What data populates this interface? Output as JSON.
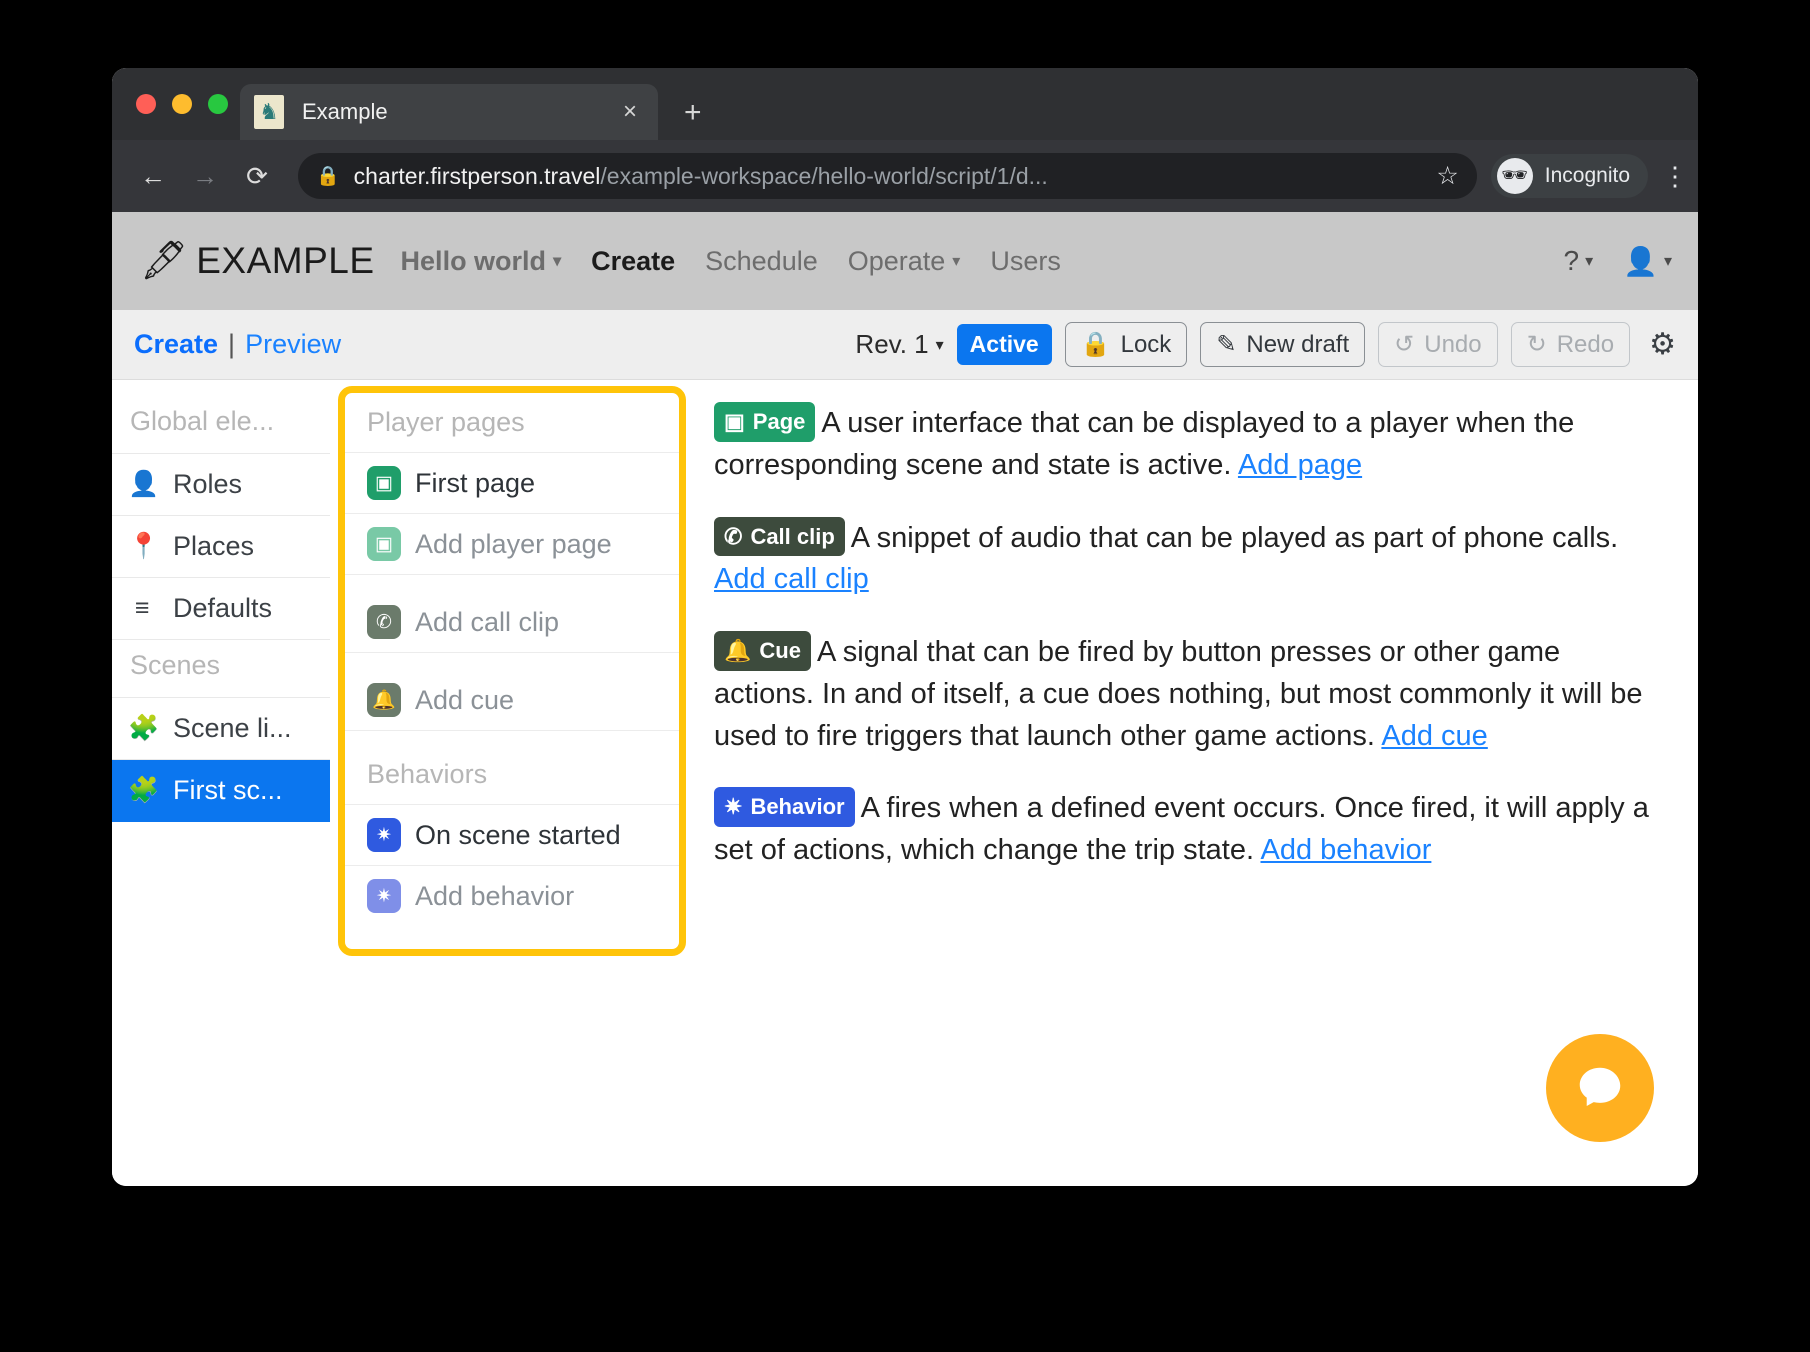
{
  "browser": {
    "tab": {
      "title": "Example",
      "favicon_icon": "chess-knight-icon",
      "close_icon": "×"
    },
    "new_tab_icon": "+",
    "nav": {
      "back_icon": "←",
      "forward_icon": "→",
      "reload_icon": "⟳"
    },
    "url": {
      "lock_icon": "lock-icon",
      "host": "charter.firstperson.travel",
      "path": "/example-workspace/hello-world/script/1/d...",
      "star_icon": "☆"
    },
    "profile": {
      "label": "Incognito",
      "icon": "incognito-hat-icon"
    },
    "menu_icon": "⋮"
  },
  "appnav": {
    "brand": "EXAMPLE",
    "brand_icon": "quill-ink-icon",
    "items": [
      {
        "label": "Hello world",
        "caret": "▾",
        "style": "bold"
      },
      {
        "label": "Create",
        "caret": "",
        "style": "active"
      },
      {
        "label": "Schedule",
        "caret": "",
        "style": "normal"
      },
      {
        "label": "Operate",
        "caret": "▾",
        "style": "normal"
      },
      {
        "label": "Users",
        "caret": "",
        "style": "normal"
      }
    ],
    "help_icon": "?",
    "help_caret": "▾",
    "user_icon": "person-icon",
    "user_caret": "▾"
  },
  "toolbar": {
    "create": "Create",
    "separator": "|",
    "preview": "Preview",
    "revision": "Rev. 1",
    "revision_caret": "▾",
    "status_badge": "Active",
    "lock": "Lock",
    "lock_icon": "padlock-icon",
    "new_draft": "New draft",
    "new_draft_icon": "pencil-icon",
    "undo": "Undo",
    "undo_icon": "undo-arrow-icon",
    "redo": "Redo",
    "redo_icon": "redo-arrow-icon",
    "settings_icon": "gear-icon"
  },
  "sidebar": {
    "group_global": "Global ele...",
    "group_scenes": "Scenes",
    "items": [
      {
        "label": "Roles",
        "icon": "person-icon",
        "selected": false
      },
      {
        "label": "Places",
        "icon": "map-pin-icon",
        "selected": false
      },
      {
        "label": "Defaults",
        "icon": "list-icon",
        "selected": false
      }
    ],
    "scenes": [
      {
        "label": "Scene li...",
        "icon": "puzzle-piece-icon",
        "selected": false
      },
      {
        "label": "First sc...",
        "icon": "puzzle-piece-icon",
        "selected": true
      }
    ]
  },
  "panel": {
    "group_player_pages": "Player pages",
    "group_behaviors": "Behaviors",
    "items": [
      {
        "label": "First page",
        "icon": "page-icon",
        "tone": "dark",
        "tile": "t-green",
        "glyph": "▣",
        "spacer": false
      },
      {
        "label": "Add player page",
        "icon": "page-add-icon",
        "tone": "grey",
        "tile": "t-green-l",
        "glyph": "▣",
        "spacer": false
      },
      {
        "label": "Add call clip",
        "icon": "phone-call-icon",
        "tone": "grey",
        "tile": "t-olive",
        "glyph": "✆",
        "spacer": true
      },
      {
        "label": "Add cue",
        "icon": "bell-icon",
        "tone": "grey",
        "tile": "t-olive",
        "glyph": "🔔",
        "spacer": true
      }
    ],
    "behaviors": [
      {
        "label": "On scene started",
        "icon": "behavior-icon",
        "tone": "dark",
        "tile": "t-blue",
        "glyph": "✷",
        "spacer": false
      },
      {
        "label": "Add behavior",
        "icon": "behavior-add-icon",
        "tone": "grey",
        "tile": "t-blue-l",
        "glyph": "✷",
        "spacer": false
      }
    ]
  },
  "help": {
    "paragraphs": [
      {
        "chip": "Page",
        "chip_icon": "page-icon",
        "chip_class": "c-page",
        "text": "A user interface that can be displayed to a player when the corresponding scene and state is active. ",
        "link": "Add page"
      },
      {
        "chip": "Call clip",
        "chip_icon": "phone-call-icon",
        "chip_class": "c-call",
        "text": "A snippet of audio that can be played as part of phone calls. ",
        "link": "Add call clip"
      },
      {
        "chip": "Cue",
        "chip_icon": "bell-icon",
        "chip_class": "c-cue",
        "text": "A signal that can be fired by button presses or other game actions. In and of itself, a cue does nothing, but most commonly it will be used to fire triggers that launch other game actions. ",
        "link": "Add cue"
      },
      {
        "chip": "Behavior",
        "chip_icon": "behavior-icon",
        "chip_class": "c-behavior",
        "text": "A fires when a defined event occurs. Once fired, it will apply a set of actions, which change the trip state. ",
        "link": "Add behavior"
      }
    ]
  },
  "intercom": {
    "icon": "chat-bubble-icon",
    "color": "#ffb020"
  }
}
